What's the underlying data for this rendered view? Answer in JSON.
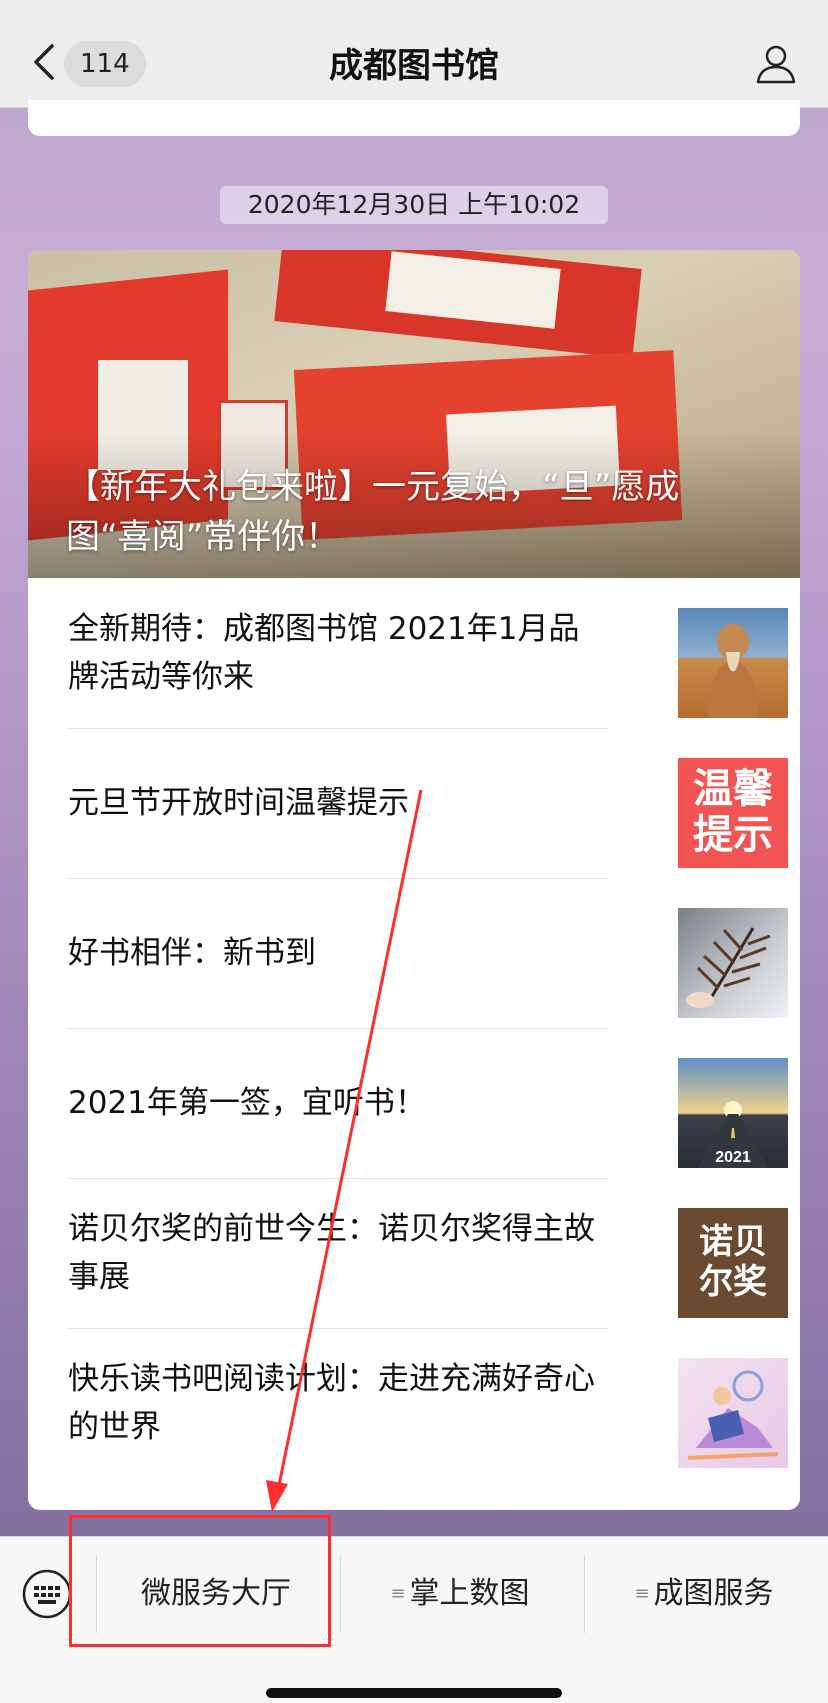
{
  "nav": {
    "back_icon": "chevron-left-icon",
    "badge": "114",
    "title": "成都图书馆",
    "profile_icon": "person-icon"
  },
  "timestamp": "2020年12月30日 上午10:02",
  "card": {
    "hero_title": "【新年大礼包来啦】一元复始，“旦”愿成图“喜阅”常伴你！",
    "items": [
      {
        "title": "全新期待：成都图书馆 2021年1月品牌活动等你来",
        "thumb": "confucius-statue-thumb"
      },
      {
        "title": "元旦节开放时间温馨提示",
        "thumb": "notice-thumb",
        "thumb_text": [
          "温馨",
          "提示"
        ]
      },
      {
        "title": "好书相伴：新书到",
        "thumb": "leaf-thumb"
      },
      {
        "title": "2021年第一签，宜听书！",
        "thumb": "road-2021-thumb",
        "thumb_text": "2021"
      },
      {
        "title": "诺贝尔奖的前世今生：诺贝尔奖得主故事展",
        "thumb": "nobel-thumb",
        "thumb_text": [
          "诺贝",
          "尔奖"
        ]
      },
      {
        "title": "快乐读书吧阅读计划：走进充满好奇心的世界",
        "thumb": "reading-illustration-thumb"
      }
    ]
  },
  "menu": {
    "keyboard_icon": "keyboard-icon",
    "items": [
      {
        "label": "微服务大厅"
      },
      {
        "label": "掌上数图"
      },
      {
        "label": "成图服务"
      }
    ]
  },
  "colors": {
    "annotation": "#ff2d2d",
    "notice_red": "#f25353",
    "nobel_brown": "#6b4a32"
  }
}
